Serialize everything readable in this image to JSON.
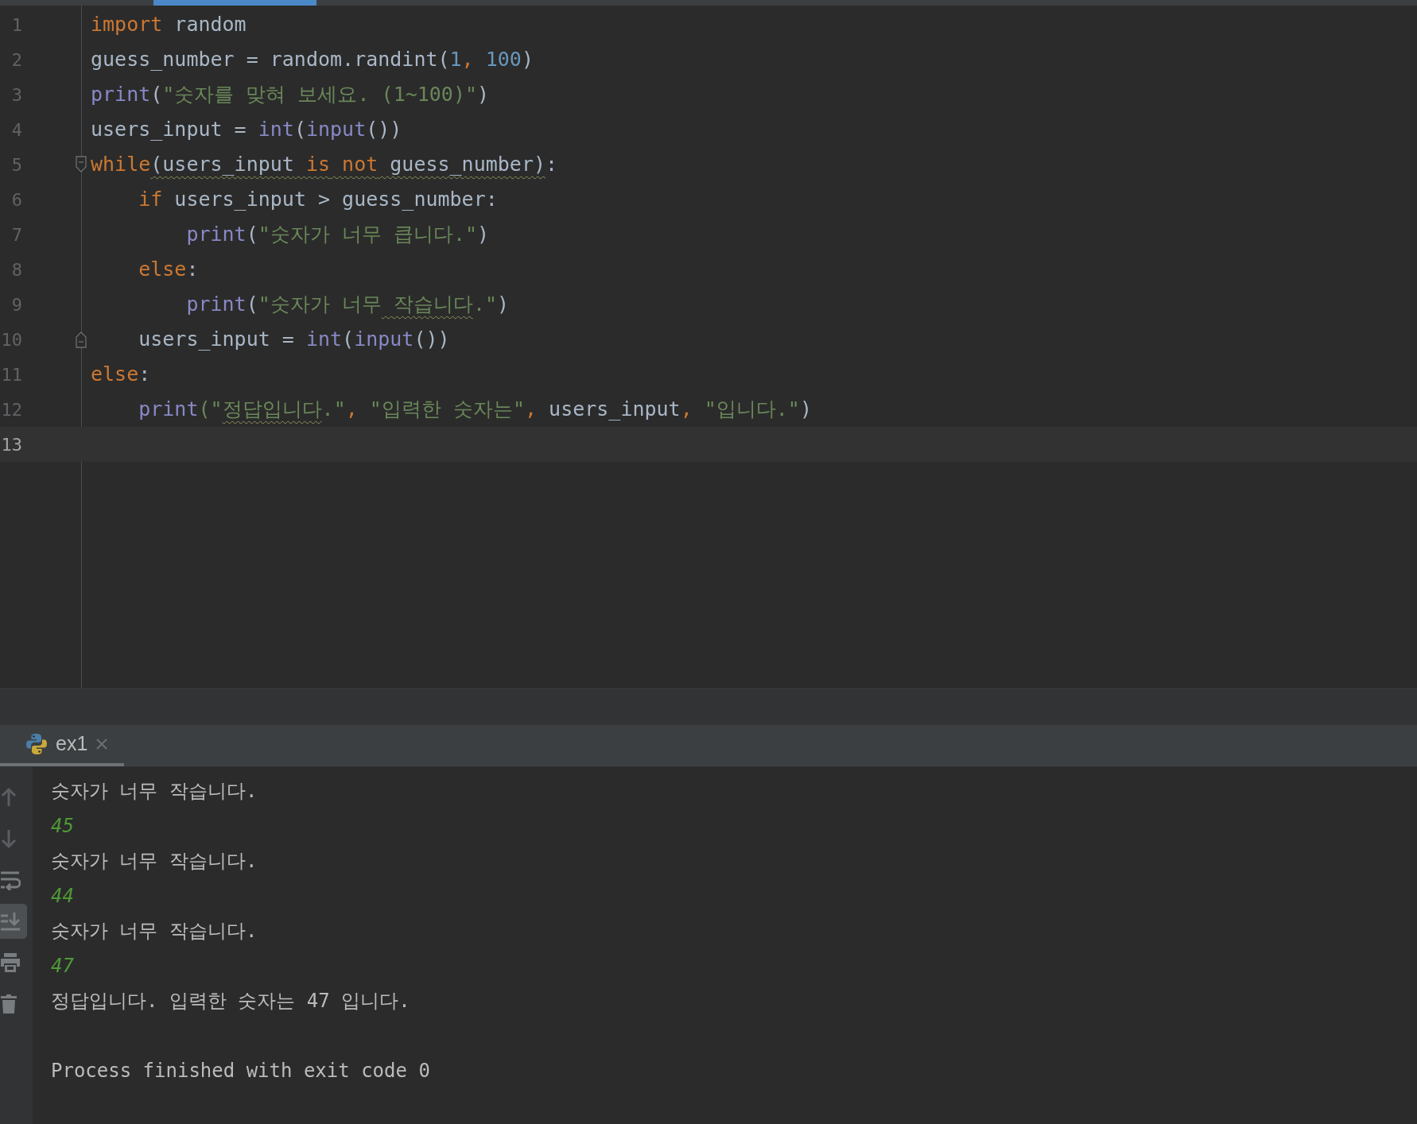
{
  "editor": {
    "lines": [
      {
        "number": "1",
        "current": false,
        "fold_start": false,
        "fold_end": false,
        "tokens": [
          {
            "text": "import",
            "kind": "kw",
            "warned": false
          },
          {
            "text": " random",
            "kind": "plain",
            "warned": false
          }
        ]
      },
      {
        "number": "2",
        "current": false,
        "fold_start": false,
        "fold_end": false,
        "tokens": [
          {
            "text": "guess_number = random.randint(",
            "kind": "plain",
            "warned": false
          },
          {
            "text": "1",
            "kind": "num",
            "warned": false
          },
          {
            "text": ",",
            "kind": "kw",
            "warned": false
          },
          {
            "text": " 100",
            "kind": "num",
            "warned": false
          },
          {
            "text": ")",
            "kind": "plain",
            "warned": false
          }
        ]
      },
      {
        "number": "3",
        "current": false,
        "fold_start": false,
        "fold_end": false,
        "tokens": [
          {
            "text": "print",
            "kind": "builtin",
            "warned": false
          },
          {
            "text": "(",
            "kind": "plain",
            "warned": false
          },
          {
            "text": "\"숫자를 맞혀 보세요. (1~100)\"",
            "kind": "str",
            "warned": false
          },
          {
            "text": ")",
            "kind": "plain",
            "warned": false
          }
        ]
      },
      {
        "number": "4",
        "current": false,
        "fold_start": false,
        "fold_end": false,
        "tokens": [
          {
            "text": "users_input = ",
            "kind": "plain",
            "warned": false
          },
          {
            "text": "int",
            "kind": "builtin",
            "warned": false
          },
          {
            "text": "(",
            "kind": "plain",
            "warned": false
          },
          {
            "text": "input",
            "kind": "builtin",
            "warned": false
          },
          {
            "text": "())",
            "kind": "plain",
            "warned": false
          }
        ]
      },
      {
        "number": "5",
        "current": false,
        "fold_start": true,
        "fold_end": false,
        "tokens": [
          {
            "text": "while",
            "kind": "kw",
            "warned": false
          },
          {
            "text": "(users_input",
            "kind": "plain",
            "warned": true
          },
          {
            "text": " is",
            "kind": "kw",
            "warned": true
          },
          {
            "text": " not",
            "kind": "kw",
            "warned": true
          },
          {
            "text": " guess_number)",
            "kind": "plain",
            "warned": true
          },
          {
            "text": ":",
            "kind": "plain",
            "warned": false
          }
        ]
      },
      {
        "number": "6",
        "current": false,
        "fold_start": false,
        "fold_end": false,
        "tokens": [
          {
            "text": "    if",
            "kind": "kw",
            "warned": false
          },
          {
            "text": " users_input > guess_number:",
            "kind": "plain",
            "warned": false
          }
        ]
      },
      {
        "number": "7",
        "current": false,
        "fold_start": false,
        "fold_end": false,
        "tokens": [
          {
            "text": "        print",
            "kind": "builtin",
            "warned": false
          },
          {
            "text": "(",
            "kind": "plain",
            "warned": false
          },
          {
            "text": "\"숫자가 너무 큽니다.\"",
            "kind": "str",
            "warned": false
          },
          {
            "text": ")",
            "kind": "plain",
            "warned": false
          }
        ]
      },
      {
        "number": "8",
        "current": false,
        "fold_start": false,
        "fold_end": false,
        "tokens": [
          {
            "text": "    else",
            "kind": "kw",
            "warned": false
          },
          {
            "text": ":",
            "kind": "plain",
            "warned": false
          }
        ]
      },
      {
        "number": "9",
        "current": false,
        "fold_start": false,
        "fold_end": false,
        "tokens": [
          {
            "text": "        print",
            "kind": "builtin",
            "warned": false
          },
          {
            "text": "(",
            "kind": "plain",
            "warned": false
          },
          {
            "text": "\"숫자가 너무",
            "kind": "str",
            "warned": false
          },
          {
            "text": " 작습니다",
            "kind": "str",
            "warned": true
          },
          {
            "text": ".\"",
            "kind": "str",
            "warned": false
          },
          {
            "text": ")",
            "kind": "plain",
            "warned": false
          }
        ]
      },
      {
        "number": "10",
        "current": false,
        "fold_start": false,
        "fold_end": true,
        "tokens": [
          {
            "text": "    users_input = ",
            "kind": "plain",
            "warned": false
          },
          {
            "text": "int",
            "kind": "builtin",
            "warned": false
          },
          {
            "text": "(",
            "kind": "plain",
            "warned": false
          },
          {
            "text": "input",
            "kind": "builtin",
            "warned": false
          },
          {
            "text": "())",
            "kind": "plain",
            "warned": false
          }
        ]
      },
      {
        "number": "11",
        "current": false,
        "fold_start": false,
        "fold_end": false,
        "tokens": [
          {
            "text": "else",
            "kind": "kw",
            "warned": false
          },
          {
            "text": ":",
            "kind": "plain",
            "warned": false
          }
        ]
      },
      {
        "number": "12",
        "current": false,
        "fold_start": false,
        "fold_end": false,
        "tokens": [
          {
            "text": "    print",
            "kind": "builtin",
            "warned": false
          },
          {
            "text": "(\"",
            "kind": "str",
            "warned": false
          },
          {
            "text": "정답입니다",
            "kind": "str",
            "warned": true
          },
          {
            "text": ".\"",
            "kind": "str",
            "warned": false
          },
          {
            "text": ",",
            "kind": "kw",
            "warned": false
          },
          {
            "text": " \"입력한 숫자는\"",
            "kind": "str",
            "warned": false
          },
          {
            "text": ",",
            "kind": "kw",
            "warned": false
          },
          {
            "text": " users_input",
            "kind": "plain",
            "warned": false
          },
          {
            "text": ",",
            "kind": "kw",
            "warned": false
          },
          {
            "text": " \"입니다.\"",
            "kind": "str",
            "warned": false
          },
          {
            "text": ")",
            "kind": "plain",
            "warned": false
          }
        ]
      },
      {
        "number": "13",
        "current": true,
        "fold_start": false,
        "fold_end": false
      }
    ]
  },
  "run_panel": {
    "tabs": [
      {
        "label": "ex1",
        "selected": true
      }
    ],
    "toolbar": [
      {
        "kind": "up",
        "active": false
      },
      {
        "kind": "down",
        "active": false
      },
      {
        "kind": "wrap",
        "active": false
      },
      {
        "kind": "scroll-end",
        "active": true
      },
      {
        "kind": "print",
        "active": false
      },
      {
        "kind": "trash",
        "active": false
      }
    ],
    "output": [
      {
        "kind": "stdout",
        "text": "숫자가 너무 작습니다."
      },
      {
        "kind": "stdin",
        "text": "45"
      },
      {
        "kind": "stdout",
        "text": "숫자가 너무 작습니다."
      },
      {
        "kind": "stdin",
        "text": "44"
      },
      {
        "kind": "stdout",
        "text": "숫자가 너무 작습니다."
      },
      {
        "kind": "stdin",
        "text": "47"
      },
      {
        "kind": "stdout",
        "text": "정답입니다. 입력한 숫자는 47 입니다."
      },
      {
        "kind": "exit",
        "text": "Process finished with exit code 0"
      }
    ]
  }
}
